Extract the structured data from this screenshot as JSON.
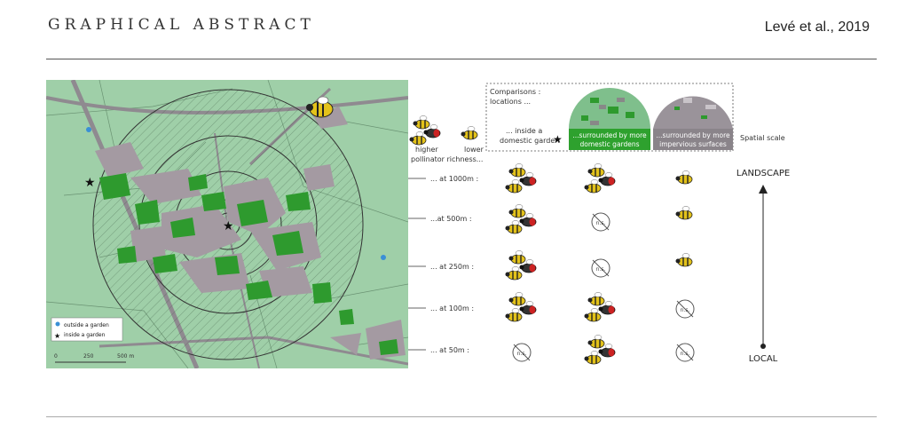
{
  "header": {
    "title": "GRAPHICAL ABSTRACT",
    "citation": "Levé et al., 2019"
  },
  "map": {
    "legend": {
      "outside": "outside a garden",
      "inside": "inside a garden"
    },
    "scalebar": {
      "ticks": [
        "0",
        "250",
        "500 m"
      ]
    }
  },
  "richness": {
    "higher": "higher",
    "lower": "lower",
    "label": "pollinator richness..."
  },
  "comparisons": {
    "title_line1": "Comparisons :",
    "title_line2": "locations ...",
    "col1_line1": "... inside a",
    "col1_line2": "domestic garden",
    "col2_line1": "...surrounded by more",
    "col2_line2": "domestic gardens",
    "col3_line1": "...surrounded by more",
    "col3_line2": "impervious surfaces",
    "spatial_scale": "Spatial scale"
  },
  "scales": [
    "... at 1000m :",
    "...at 500m :",
    "... at 250m :",
    "... at 100m :",
    "... at 50m :"
  ],
  "ns_label": "n.s.",
  "axis": {
    "top": "LANDSCAPE",
    "bottom": "LOCAL"
  },
  "colors": {
    "map_bg": "#9fcfa8",
    "garden": "#2e9a2e",
    "impervious": "#a49aa2",
    "bee": "#e3c21a"
  }
}
